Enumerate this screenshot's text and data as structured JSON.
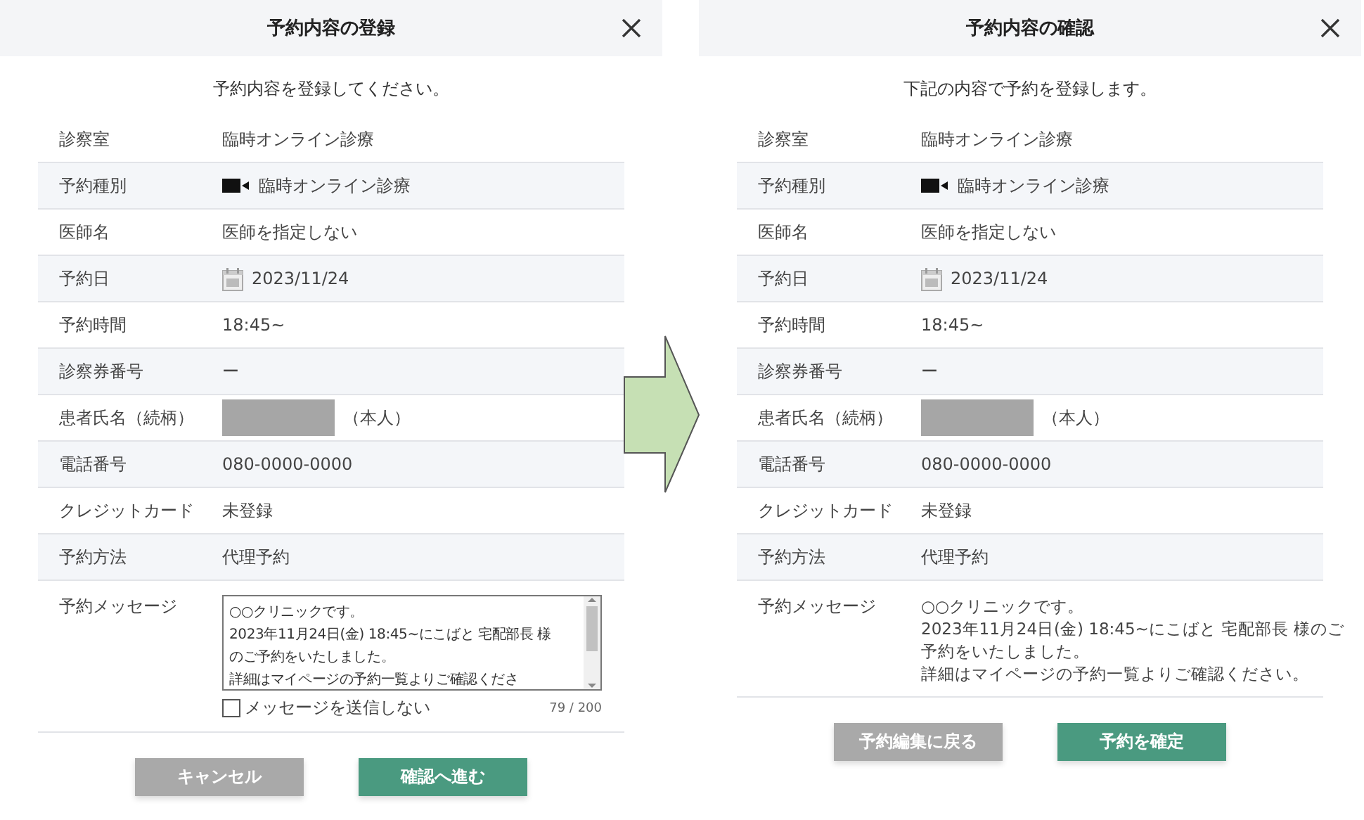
{
  "dialogs": [
    {
      "title": "予約内容の登録",
      "lead": "予約内容を登録してください。",
      "rows": [
        {
          "label": "診察室",
          "kind": "text",
          "value": "臨時オンライン診療"
        },
        {
          "label": "予約種別",
          "kind": "video",
          "value": "臨時オンライン診療"
        },
        {
          "label": "医師名",
          "kind": "text",
          "value": "医師を指定しない"
        },
        {
          "label": "予約日",
          "kind": "date",
          "value": "2023/11/24"
        },
        {
          "label": "予約時間",
          "kind": "text",
          "value": "18:45~"
        },
        {
          "label": "診察券番号",
          "kind": "text",
          "value": "ー"
        },
        {
          "label": "患者氏名（続柄）",
          "kind": "redacted",
          "value": "（本人）"
        },
        {
          "label": "電話番号",
          "kind": "text",
          "value": "080-0000-0000"
        },
        {
          "label": "クレジットカード",
          "kind": "text",
          "value": "未登録"
        },
        {
          "label": "予約方法",
          "kind": "text",
          "value": "代理予約"
        },
        {
          "label": "予約メッセージ",
          "kind": "textarea",
          "lines": [
            "○○クリニックです。",
            "2023年11月24日(金) 18:45~にこばと 宅配部長 様",
            "のご予約をいたしました。",
            "詳細はマイページの予約一覧よりご確認くださ"
          ],
          "checkbox": {
            "label": "メッセージを送信しない",
            "checked": false
          },
          "count": "79 / 200"
        }
      ],
      "buttons": [
        {
          "label": "キャンセル",
          "kind": "secondary"
        },
        {
          "label": "確認へ進む",
          "kind": "primary"
        }
      ]
    },
    {
      "title": "予約内容の確認",
      "lead": "下記の内容で予約を登録します。",
      "rows": [
        {
          "label": "診察室",
          "kind": "text",
          "value": "臨時オンライン診療"
        },
        {
          "label": "予約種別",
          "kind": "video",
          "value": "臨時オンライン診療"
        },
        {
          "label": "医師名",
          "kind": "text",
          "value": "医師を指定しない"
        },
        {
          "label": "予約日",
          "kind": "date",
          "value": "2023/11/24"
        },
        {
          "label": "予約時間",
          "kind": "text",
          "value": "18:45~"
        },
        {
          "label": "診察券番号",
          "kind": "text",
          "value": "ー"
        },
        {
          "label": "患者氏名（続柄）",
          "kind": "redacted",
          "value": "（本人）"
        },
        {
          "label": "電話番号",
          "kind": "text",
          "value": "080-0000-0000"
        },
        {
          "label": "クレジットカード",
          "kind": "text",
          "value": "未登録"
        },
        {
          "label": "予約方法",
          "kind": "text",
          "value": "代理予約"
        },
        {
          "label": "予約メッセージ",
          "kind": "message",
          "lines": [
            "○○クリニックです。",
            "2023年11月24日(金) 18:45~にこばと 宅配部長 様のご",
            "予約をいたしました。",
            "詳細はマイページの予約一覧よりご確認ください。"
          ]
        }
      ],
      "buttons": [
        {
          "label": "予約編集に戻る",
          "kind": "secondary"
        },
        {
          "label": "予約を確定",
          "kind": "primary"
        }
      ]
    }
  ]
}
